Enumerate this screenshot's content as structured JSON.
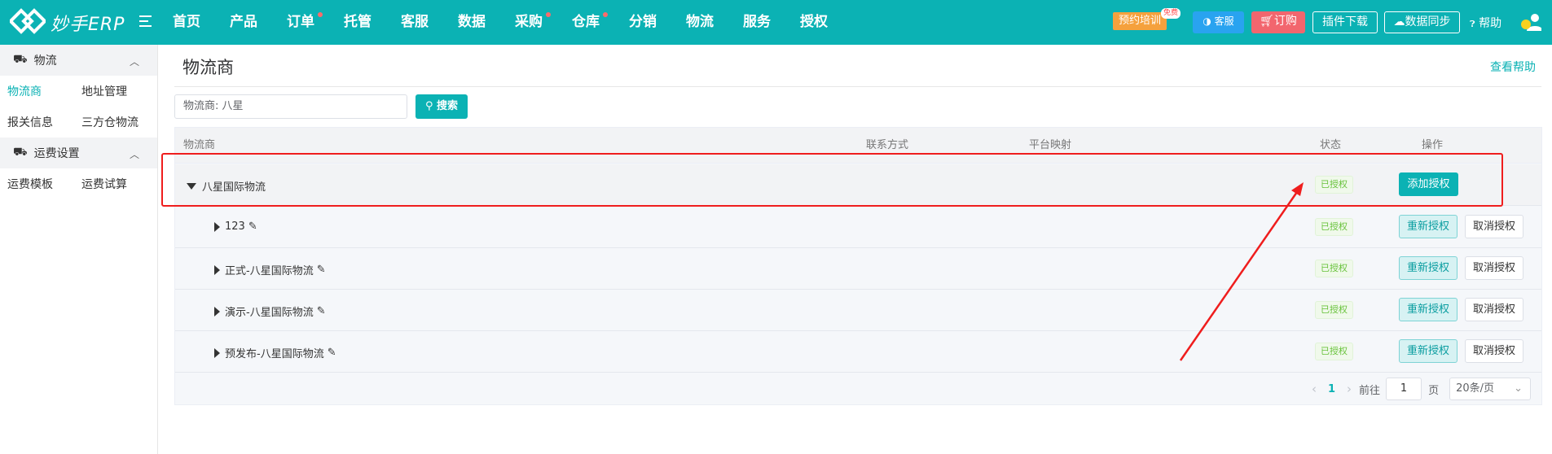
{
  "header": {
    "logo_text": "妙手ERP",
    "nav": [
      {
        "label": "首页",
        "dot": false
      },
      {
        "label": "产品",
        "dot": false
      },
      {
        "label": "订单",
        "dot": true
      },
      {
        "label": "托管",
        "dot": false
      },
      {
        "label": "客服",
        "dot": false
      },
      {
        "label": "数据",
        "dot": false
      },
      {
        "label": "采购",
        "dot": true
      },
      {
        "label": "仓库",
        "dot": true
      },
      {
        "label": "分销",
        "dot": false
      },
      {
        "label": "物流",
        "dot": false
      },
      {
        "label": "服务",
        "dot": false
      },
      {
        "label": "授权",
        "dot": false
      }
    ],
    "training_label": "预约培训",
    "free_badge": "免费",
    "service_label": "客服",
    "order_label": "订购",
    "plugin_label": "插件下载",
    "sync_label": "数据同步",
    "help_label": "帮助"
  },
  "sidebar": {
    "group1": "物流",
    "group1_items": [
      "物流商",
      "地址管理",
      "报关信息",
      "三方仓物流"
    ],
    "group2": "运费设置",
    "group2_items": [
      "运费模板",
      "运费试算"
    ]
  },
  "main": {
    "title": "物流商",
    "help_link": "查看帮助",
    "search_text": "物流商:  八星",
    "search_button": "搜索",
    "columns": {
      "provider": "物流商",
      "contact": "联系方式",
      "mapping": "平台映射",
      "status": "状态",
      "action": "操作"
    },
    "parent_row": {
      "name": "八星国际物流",
      "status": "已授权",
      "action": "添加授权"
    },
    "child_rows": [
      {
        "name": "123",
        "status": "已授权",
        "reauth": "重新授权",
        "cancel": "取消授权"
      },
      {
        "name": "正式-八星国际物流",
        "status": "已授权",
        "reauth": "重新授权",
        "cancel": "取消授权"
      },
      {
        "name": "演示-八星国际物流",
        "status": "已授权",
        "reauth": "重新授权",
        "cancel": "取消授权"
      },
      {
        "name": "预发布-八星国际物流",
        "status": "已授权",
        "reauth": "重新授权",
        "cancel": "取消授权"
      }
    ],
    "pagination": {
      "current": "1",
      "goto_label": "前往",
      "goto_value": "1",
      "page_suffix": "页",
      "page_size": "20条/页"
    }
  },
  "colors": {
    "brand": "#0bb2b4",
    "annotation": "#ef1d1d"
  }
}
